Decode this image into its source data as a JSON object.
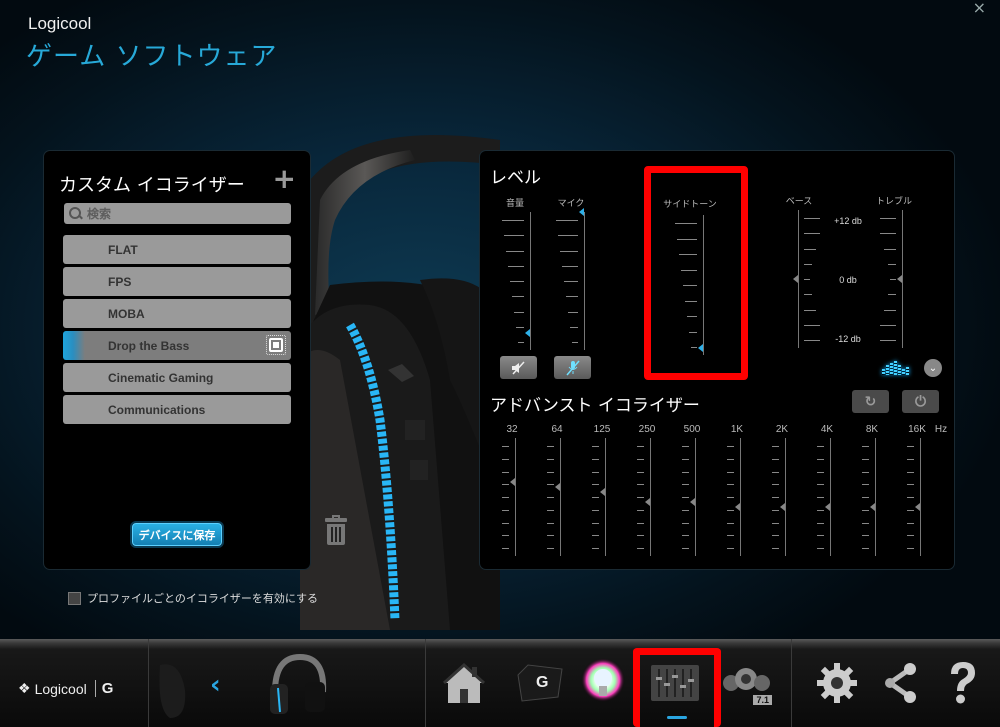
{
  "window": {
    "brand": "Logicool",
    "title": "ゲーム ソフトウェア",
    "close_glyph": "×"
  },
  "equalizer_list": {
    "title": "カスタム イコライザー",
    "add_glyph": "+",
    "search_placeholder": "検索",
    "presets": [
      {
        "label": "FLAT",
        "active": false
      },
      {
        "label": "FPS",
        "active": false
      },
      {
        "label": "MOBA",
        "active": false
      },
      {
        "label": "Drop the Bass",
        "active": true,
        "on_device": true
      },
      {
        "label": "Cinematic Gaming",
        "active": false
      },
      {
        "label": "Communications",
        "active": false
      }
    ],
    "save_button": "デバイスに保存",
    "profile_checkbox_label": "プロファイルごとのイコライザーを有効にする",
    "profile_checkbox_checked": false
  },
  "levels": {
    "title": "レベル",
    "volume": {
      "label": "音量",
      "value_percent": 12
    },
    "mic": {
      "label": "マイク",
      "value_percent": 100
    },
    "sidetone": {
      "label": "サイドトーン",
      "value_percent": 5
    },
    "bass": {
      "label": "ベース",
      "value_db": 0
    },
    "treble": {
      "label": "トレブル",
      "value_db": 0
    },
    "db_labels": [
      "+12 db",
      "0 db",
      "-12 db"
    ],
    "volume_mute_icon": "speaker-mute",
    "mic_mute_icon": "mic-mute"
  },
  "advanced_eq": {
    "title": "アドバンスト イコライザー",
    "unit": "Hz",
    "bands": [
      {
        "freq": "32",
        "value_db": 3
      },
      {
        "freq": "64",
        "value_db": 2
      },
      {
        "freq": "125",
        "value_db": 1
      },
      {
        "freq": "250",
        "value_db": -1
      },
      {
        "freq": "500",
        "value_db": -1
      },
      {
        "freq": "1K",
        "value_db": -2
      },
      {
        "freq": "2K",
        "value_db": -2
      },
      {
        "freq": "4K",
        "value_db": -2
      },
      {
        "freq": "8K",
        "value_db": -2
      },
      {
        "freq": "16K",
        "value_db": -2
      }
    ]
  },
  "taskbar": {
    "logo_text": "Logicool",
    "logo_g": "G",
    "prev_glyph": "‹",
    "surround_badge": "7.1",
    "active_item": "equalizer"
  },
  "colors": {
    "accent": "#27a9d8",
    "highlight": "#ff0000"
  }
}
